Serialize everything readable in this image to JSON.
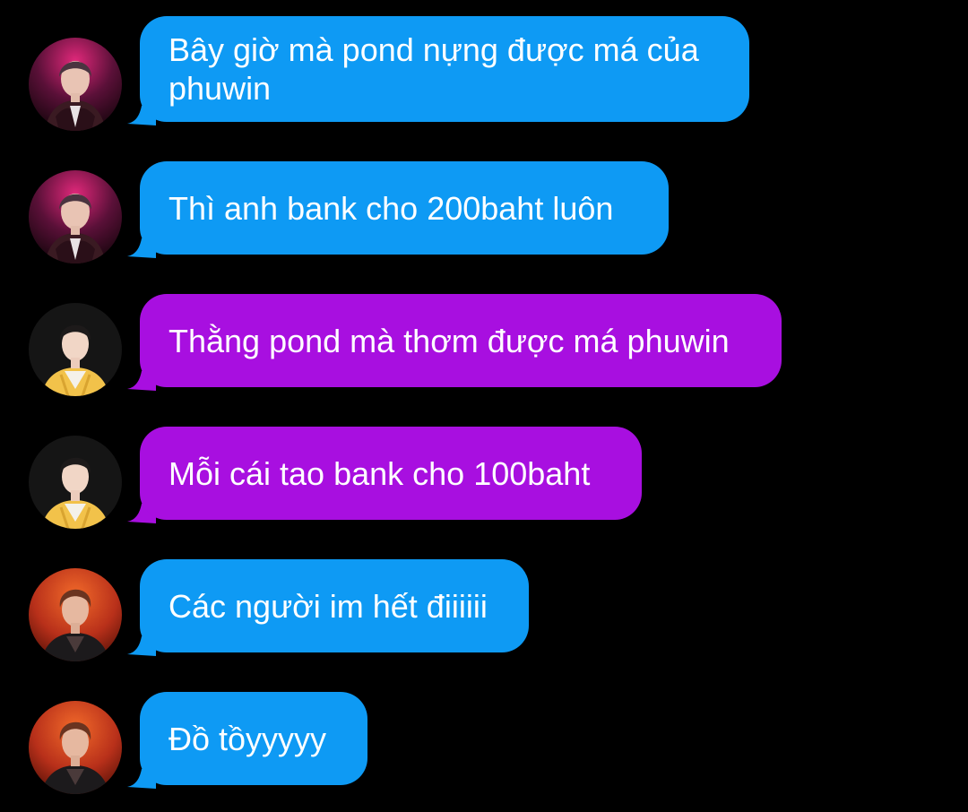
{
  "colors": {
    "background": "#000000",
    "blue_bubble": "#0e9af4",
    "purple_bubble": "#a80fe0",
    "text": "#ffffff"
  },
  "messages": [
    {
      "sender_avatar": "avatar-pink-stage",
      "bubble_color": "blue",
      "text": "Bây giờ mà pond nựng được má của phuwin"
    },
    {
      "sender_avatar": "avatar-pink-stage",
      "bubble_color": "blue",
      "text": "Thì anh bank cho 200baht luôn"
    },
    {
      "sender_avatar": "avatar-yellow-jacket",
      "bubble_color": "purple",
      "text": "Thằng pond mà thơm được má phuwin"
    },
    {
      "sender_avatar": "avatar-yellow-jacket",
      "bubble_color": "purple",
      "text": "Mỗi cái tao bank cho 100baht"
    },
    {
      "sender_avatar": "avatar-orange-stage",
      "bubble_color": "blue",
      "text": "Các người im hết điiiiii"
    },
    {
      "sender_avatar": "avatar-orange-stage",
      "bubble_color": "blue",
      "text": "Đồ tồyyyyy"
    }
  ]
}
